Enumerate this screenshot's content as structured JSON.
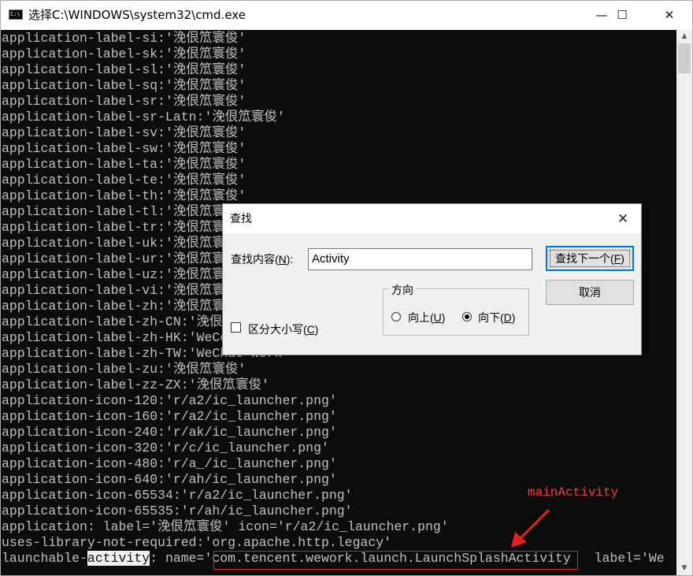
{
  "window": {
    "title": "选择C:\\WINDOWS\\system32\\cmd.exe",
    "app_icon_text": "C:\\",
    "minimize_glyph": "—",
    "maximize_glyph": "☐",
    "close_glyph": "✕"
  },
  "console": {
    "lines": [
      "application-label-si:'浼佷笟寰俊'",
      "application-label-sk:'浼佷笟寰俊'",
      "application-label-sl:'浼佷笟寰俊'",
      "application-label-sq:'浼佷笟寰俊'",
      "application-label-sr:'浼佷笟寰俊'",
      "application-label-sr-Latn:'浼佷笟寰俊'",
      "application-label-sv:'浼佷笟寰俊'",
      "application-label-sw:'浼佷笟寰俊'",
      "application-label-ta:'浼佷笟寰俊'",
      "application-label-te:'浼佷笟寰俊'",
      "application-label-th:'浼佷笟寰俊'",
      "application-label-tl:'浼佷笟寰俊'",
      "application-label-tr:'浼佷笟寰俊'",
      "application-label-uk:'浼佷笟寰俊'",
      "application-label-ur:'浼佷笟寰俊'",
      "application-label-uz:'浼佷笟寰俊'",
      "application-label-vi:'浼佷笟寰俊'",
      "application-label-zh:'浼佷笟寰俊'",
      "application-label-zh-CN:'浼佷笟寰俊'",
      "application-label-zh-HK:'WeCom Work'",
      "application-label-zh-TW:'WeChat Work'",
      "application-label-zu:'浼佷笟寰俊'",
      "application-label-zz-ZX:'浼佷笟寰俊'",
      "application-icon-120:'r/a2/ic_launcher.png'",
      "application-icon-160:'r/a2/ic_launcher.png'",
      "application-icon-240:'r/ak/ic_launcher.png'",
      "application-icon-320:'r/c/ic_launcher.png'",
      "application-icon-480:'r/a_/ic_launcher.png'",
      "application-icon-640:'r/ah/ic_launcher.png'",
      "application-icon-65534:'r/a2/ic_launcher.png'",
      "application-icon-65535:'r/ah/ic_launcher.png'",
      "application: label='浼佷笟寰俊' icon='r/a2/ic_launcher.png'",
      "uses-library-not-required:'org.apache.http.legacy'"
    ],
    "last_line": {
      "prefix": "launchable-",
      "highlight": "activity",
      "middle": ": name='",
      "activity": "com.tencent.wework.launch.LaunchSplashActivity",
      "suffix": "   label='We"
    },
    "annotation": "mainActivity",
    "accent_color": "#e62020"
  },
  "find_dialog": {
    "title": "查找",
    "close_glyph": "✕",
    "find_label": "查找内容(",
    "find_label_key": "N",
    "find_label_end": "):",
    "find_value": "Activity",
    "find_next_label": "查找下一个(",
    "find_next_key": "F",
    "find_next_end": ")",
    "cancel_label": "取消",
    "direction_label": "方向",
    "up_label": "向上(",
    "up_key": "U",
    "up_end": ")",
    "down_label": "向下(",
    "down_key": "D",
    "down_end": ")",
    "direction_selected": "down",
    "match_case_label": "区分大小写(",
    "match_case_key": "C",
    "match_case_end": ")",
    "match_case_checked": false
  }
}
